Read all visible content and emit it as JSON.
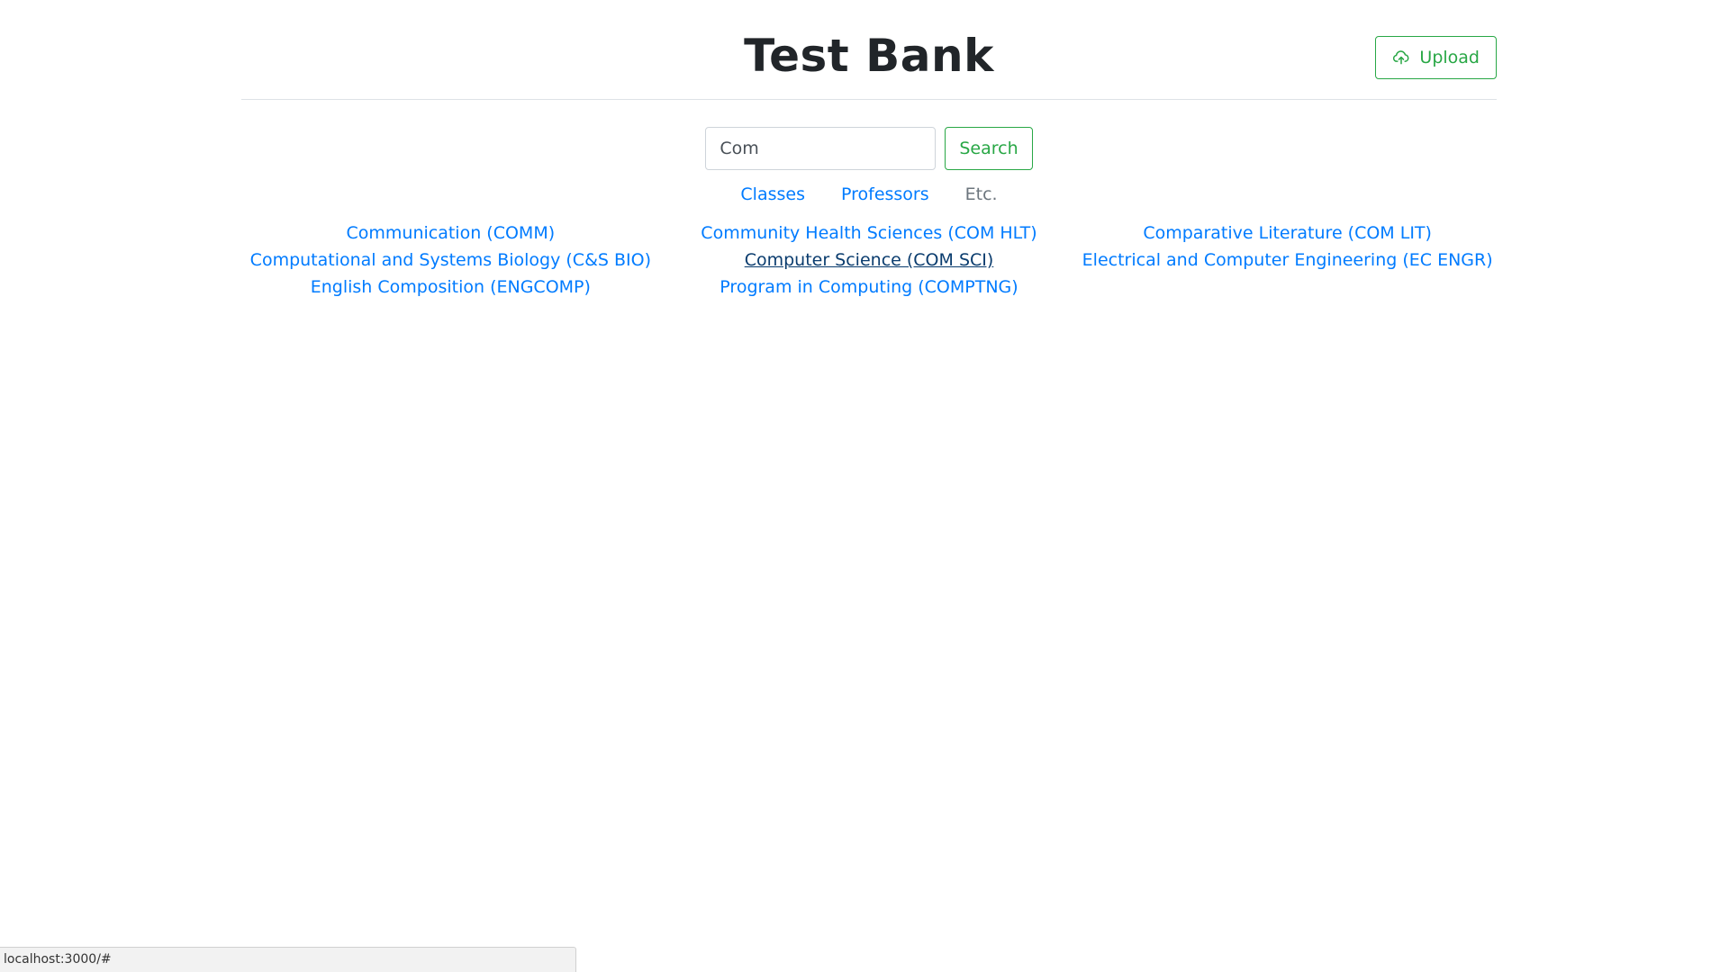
{
  "header": {
    "title": "Test Bank",
    "upload_label": "Upload",
    "upload_icon": "cloud-upload-icon"
  },
  "search": {
    "value": "Com",
    "button_label": "Search"
  },
  "filters": {
    "classes": "Classes",
    "professors": "Professors",
    "etc": "Etc."
  },
  "results": {
    "columns": [
      [
        "Communication (COMM)",
        "Computational and Systems Biology (C&S BIO)",
        "English Composition (ENGCOMP)"
      ],
      [
        "Community Health Sciences (COM HLT)",
        "Computer Science (COM SCI)",
        "Program in Computing (COMPTNG)"
      ],
      [
        "Comparative Literature (COM LIT)",
        "Electrical and Computer Engineering (EC ENGR)"
      ]
    ],
    "hovered": "Computer Science (COM SCI)"
  },
  "status_bar": {
    "url": "localhost:3000/#"
  },
  "colors": {
    "link": "#007bff",
    "success": "#28a745",
    "muted": "#6c757d"
  }
}
